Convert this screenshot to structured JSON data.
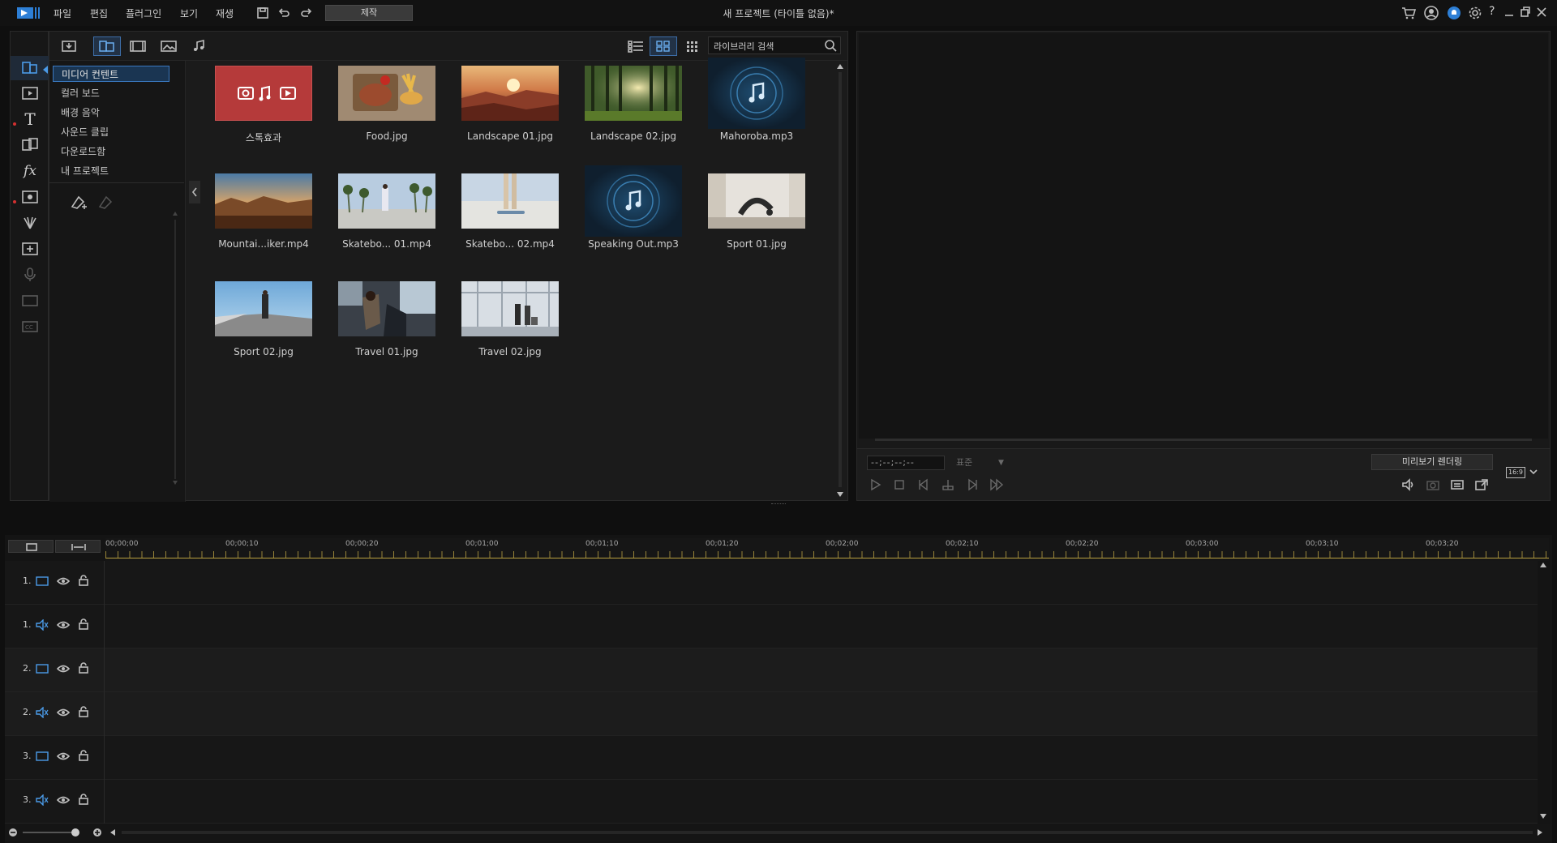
{
  "app": {
    "title": "새 프로젝트 (타이틀 없음)*",
    "menu": [
      "파일",
      "편집",
      "플러그인",
      "보기",
      "재생"
    ],
    "produce_label": "제작"
  },
  "library": {
    "search_placeholder": "라이브러리 검색",
    "categories": [
      "미디어 컨텐트",
      "컬러 보드",
      "배경 음악",
      "사운드 클립",
      "다운로드함",
      "내 프로젝트"
    ],
    "items": [
      {
        "name": "스톡효과",
        "type": "stock"
      },
      {
        "name": "Food.jpg",
        "type": "image"
      },
      {
        "name": "Landscape 01.jpg",
        "type": "image"
      },
      {
        "name": "Landscape 02.jpg",
        "type": "image"
      },
      {
        "name": "Mahoroba.mp3",
        "type": "audio"
      },
      {
        "name": "Mountai...iker.mp4",
        "type": "video"
      },
      {
        "name": "Skatebo... 01.mp4",
        "type": "video"
      },
      {
        "name": "Skatebo... 02.mp4",
        "type": "video"
      },
      {
        "name": "Speaking Out.mp3",
        "type": "audio"
      },
      {
        "name": "Sport 01.jpg",
        "type": "image"
      },
      {
        "name": "Sport 02.jpg",
        "type": "image"
      },
      {
        "name": "Travel 01.jpg",
        "type": "image"
      },
      {
        "name": "Travel 02.jpg",
        "type": "image"
      }
    ]
  },
  "preview": {
    "timecode": "--;--;--;--",
    "quality": "표준",
    "render_label": "미리보기 렌더링",
    "aspect": "16:9"
  },
  "timeline": {
    "ruler": [
      "00;00;00",
      "00;00;10",
      "00;00;20",
      "00;01;00",
      "00;01;10",
      "00;01;20",
      "00;02;00",
      "00;02;10",
      "00;02;20",
      "00;03;00",
      "00;03;10",
      "00;03;20"
    ],
    "tracks": [
      {
        "label": "1.",
        "kind": "video"
      },
      {
        "label": "1.",
        "kind": "audio"
      },
      {
        "label": "2.",
        "kind": "video"
      },
      {
        "label": "2.",
        "kind": "audio"
      },
      {
        "label": "3.",
        "kind": "video"
      },
      {
        "label": "3.",
        "kind": "audio"
      }
    ]
  },
  "colors": {
    "accent": "#3a78c0",
    "stock_tile": "#b53a3a",
    "ruler_ticks": "#b8a040"
  }
}
